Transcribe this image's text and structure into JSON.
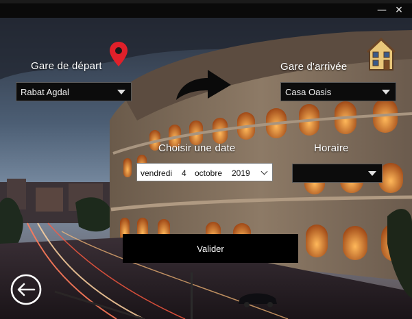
{
  "window": {
    "minimize_glyph": "—",
    "close_glyph": "✕"
  },
  "departure": {
    "label": "Gare de départ",
    "value": "Rabat Agdal"
  },
  "arrival": {
    "label": "Gare d'arrivée",
    "value": "Casa Oasis"
  },
  "date": {
    "label": "Choisir une date",
    "weekday": "vendredi",
    "day": "4",
    "month": "octobre",
    "year": "2019"
  },
  "schedule": {
    "label": "Horaire",
    "value": ""
  },
  "submit_label": "Valider",
  "icons": {
    "location": "location-pin-icon",
    "direction": "curved-arrow-icon",
    "station": "house-icon",
    "back": "back-arrow-icon"
  },
  "colors": {
    "pin": "#e0202a",
    "field_bg": "#0c0c0c",
    "button_bg": "#000000"
  }
}
